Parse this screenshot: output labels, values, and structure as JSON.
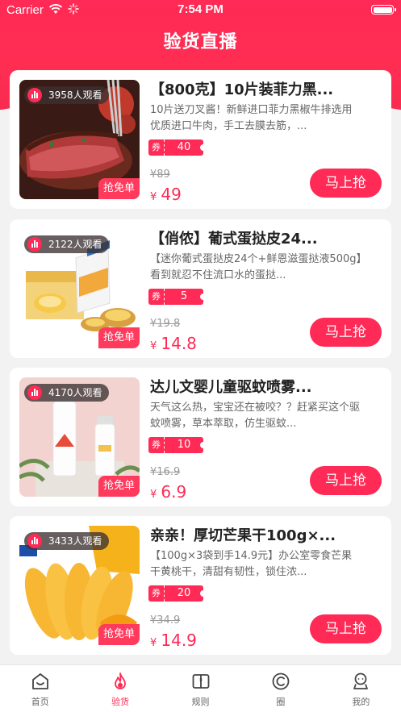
{
  "status_bar": {
    "carrier": "Carrier",
    "time": "7:54 PM"
  },
  "header": {
    "title": "验货直播"
  },
  "products": [
    {
      "viewers": "3958人观看",
      "title": "【800克】10片装菲力黑...",
      "desc": "10片送刀叉酱！新鲜进口菲力黑椒牛排选用优质进口牛肉，手工去膜去筋，...",
      "coupon_label": "券",
      "coupon_value": "40",
      "old_price": "¥89",
      "currency": "¥",
      "price": "49",
      "free_tag": "抢免单",
      "buy_label": "马上抢"
    },
    {
      "viewers": "2122人观看",
      "title": "【俏侬】葡式蛋挞皮24...",
      "desc": "【迷你葡式蛋挞皮24个+鲜恩滋蛋挞液500g】看到就忍不住流口水的蛋挞...",
      "coupon_label": "券",
      "coupon_value": "5",
      "old_price": "¥19.8",
      "currency": "¥",
      "price": "14.8",
      "free_tag": "抢免单",
      "buy_label": "马上抢"
    },
    {
      "viewers": "4170人观看",
      "title": "达儿文婴儿童驱蚊喷雾...",
      "desc": "天气这么热，宝宝还在被咬？？赶紧买这个驱蚊喷雾，草本萃取，仿生驱蚊...",
      "coupon_label": "券",
      "coupon_value": "10",
      "old_price": "¥16.9",
      "currency": "¥",
      "price": "6.9",
      "free_tag": "抢免单",
      "buy_label": "马上抢"
    },
    {
      "viewers": "3433人观看",
      "title": "亲亲！厚切芒果干100g×...",
      "desc": "【100g×3袋到手14.9元】办公室零食芒果干黄桃干，清甜有韧性，锁住浓...",
      "coupon_label": "券",
      "coupon_value": "20",
      "old_price": "¥34.9",
      "currency": "¥",
      "price": "14.9",
      "free_tag": "抢免单",
      "buy_label": "马上抢"
    }
  ],
  "tabbar": [
    {
      "label": "首页",
      "icon": "home-icon",
      "active": false
    },
    {
      "label": "验货",
      "icon": "flame-icon",
      "active": true
    },
    {
      "label": "规则",
      "icon": "book-icon",
      "active": false
    },
    {
      "label": "圈",
      "icon": "circle-c-icon",
      "active": false
    },
    {
      "label": "我的",
      "icon": "user-icon",
      "active": false
    }
  ],
  "colors": {
    "accent": "#ff2a55",
    "background": "#f2f2f2"
  }
}
